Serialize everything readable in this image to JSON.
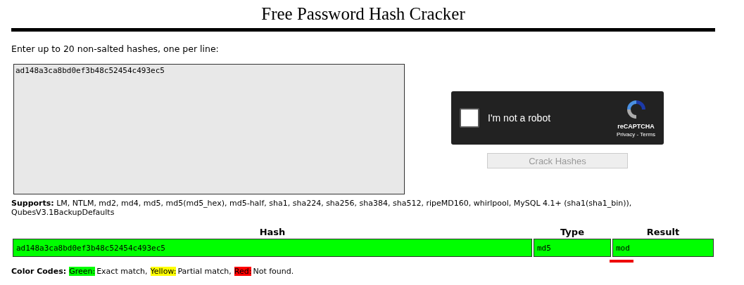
{
  "title": "Free Password Hash Cracker",
  "prompt": "Enter up to 20 non-salted hashes, one per line:",
  "hashes_input": {
    "value": "ad148a3ca8bd0ef3b48c52454c493ec5"
  },
  "captcha": {
    "label": "I'm not a robot",
    "checked": false,
    "brand": "reCAPTCHA",
    "links": "Privacy - Terms"
  },
  "crack_button": {
    "label": "Crack Hashes",
    "disabled": true
  },
  "supports": "**Supports:** LM, NTLM, md2, md4, md5, md5(md5_hex), md5-half, sha1, sha224, sha256, sha384, sha512, ripeMD160, whirlpool, MySQL 4.1+ (sha1(sha1_bin)), QubesV3.1BackupDefaults",
  "table": {
    "columns": [
      "Hash",
      "Type",
      "Result"
    ],
    "rows": [
      {
        "hash": "ad148a3ca8bd0ef3b48c52454c493ec5",
        "type": "md5",
        "result": "mod",
        "color": "#00ff00"
      }
    ]
  },
  "color_codes": {
    "label": "Color Codes:",
    "items": [
      {
        "name": "Green:",
        "color": "#00ff00",
        "text": "Exact match,"
      },
      {
        "name": "Yellow:",
        "color": "#ffff00",
        "text": "Partial match,"
      },
      {
        "name": "Red:",
        "color": "#ff0000",
        "text": "Not found."
      }
    ]
  }
}
